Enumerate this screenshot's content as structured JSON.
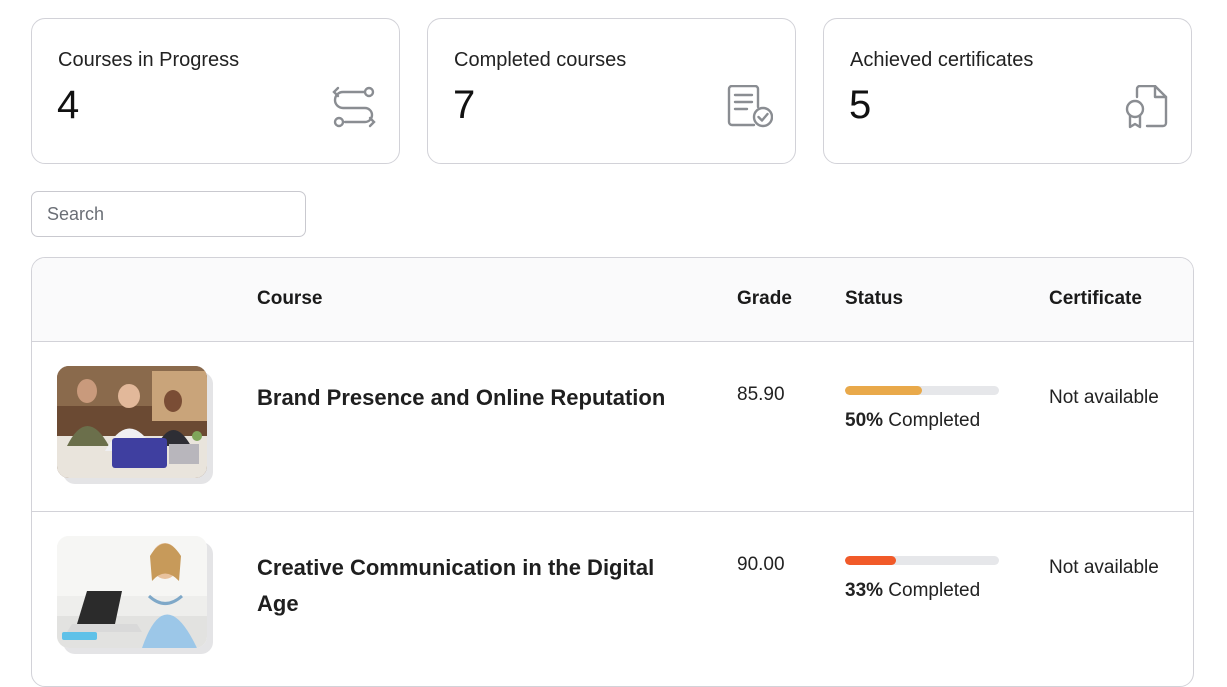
{
  "stats": [
    {
      "title": "Courses in Progress",
      "value": "4",
      "icon": "progress-route-icon"
    },
    {
      "title": "Completed courses",
      "value": "7",
      "icon": "completed-document-icon"
    },
    {
      "title": "Achieved certificates",
      "value": "5",
      "icon": "certificate-icon"
    }
  ],
  "search": {
    "placeholder": "Search"
  },
  "table": {
    "headers": {
      "course": "Course",
      "grade": "Grade",
      "status": "Status",
      "certificate": "Certificate"
    },
    "rows": [
      {
        "course": "Brand Presence and Online Reputation",
        "grade": "85.90",
        "progress_percent": 50,
        "progress_value": "50%",
        "progress_suffix": " Completed",
        "progress_color": "#E9A94A",
        "certificate": "Not available"
      },
      {
        "course": "Creative Communication in the Digital Age",
        "grade": "90.00",
        "progress_percent": 33,
        "progress_value": "33%",
        "progress_suffix": " Completed",
        "progress_color": "#F15A29",
        "certificate": "Not available"
      }
    ]
  }
}
